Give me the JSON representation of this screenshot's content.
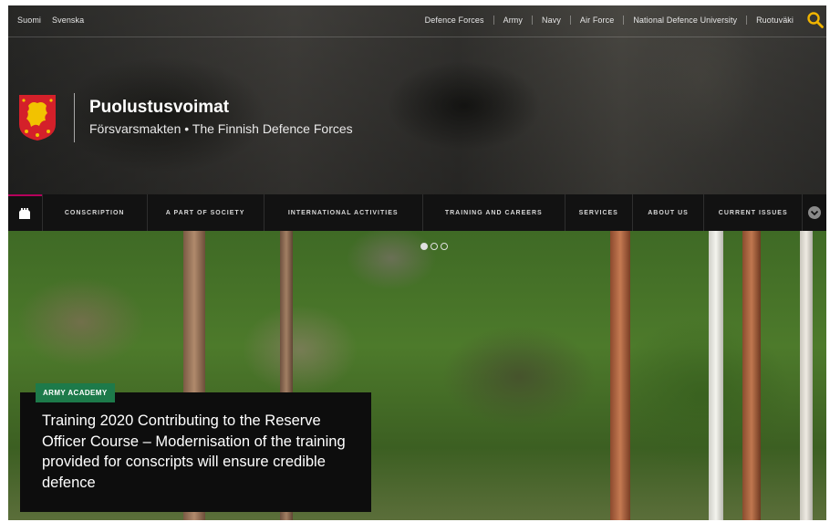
{
  "languages": [
    "Suomi",
    "Svenska"
  ],
  "top_links": [
    "Defence Forces",
    "Army",
    "Navy",
    "Air Force",
    "National Defence University",
    "Ruotuväki"
  ],
  "icons": {
    "search": "search-icon",
    "home": "home-icon",
    "more": "chevron-down-icon",
    "crest": "lion-crest-icon"
  },
  "brand": {
    "name": "Puolustusvoimat",
    "subtitle": "Försvarsmakten • The Finnish Defence Forces"
  },
  "nav": {
    "items": [
      "Conscription",
      "A part of society",
      "International activities",
      "Training and careers",
      "Services",
      "About us",
      "Current issues"
    ]
  },
  "hero": {
    "slides_total": 3,
    "active_slide": 1,
    "badge": "ARMY ACADEMY",
    "headline": "Training 2020 Contributing to the Reserve Officer Course – Modernisation of the training provided for conscripts will ensure credible defence"
  },
  "colors": {
    "accent": "#b5005b",
    "badge": "#1d7a4a",
    "search": "#f0b400",
    "nav_bg": "#121212",
    "crest_red": "#d4202a",
    "crest_gold": "#f2c200"
  }
}
